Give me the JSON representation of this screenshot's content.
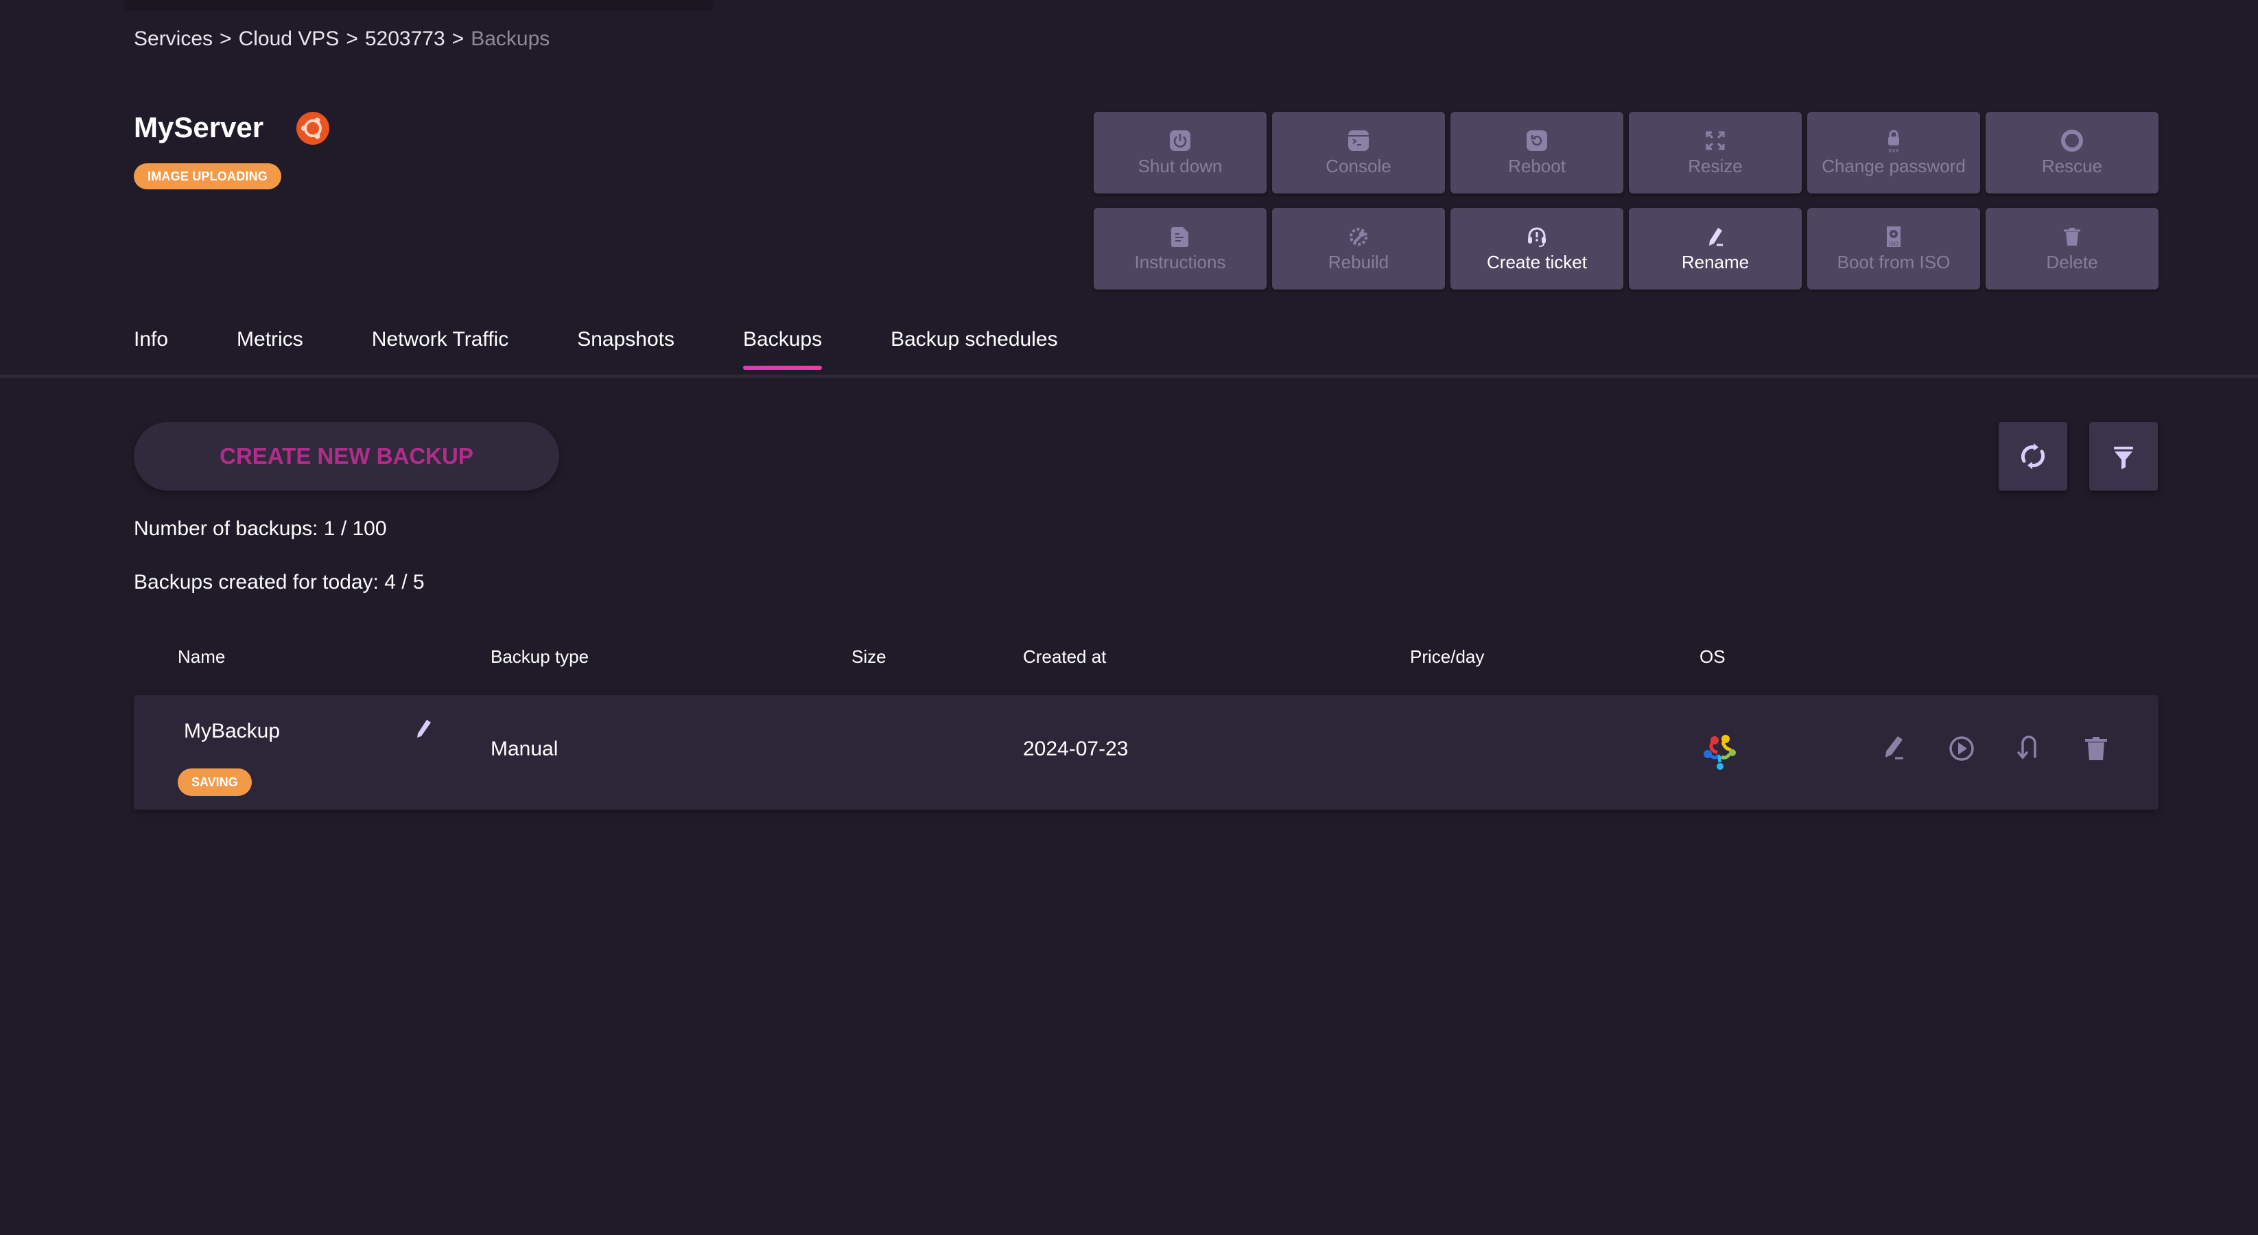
{
  "breadcrumb": [
    {
      "label": "Services"
    },
    {
      "label": "Cloud VPS"
    },
    {
      "label": "5203773"
    },
    {
      "label": "Backups"
    }
  ],
  "breadcrumb_separator": ">",
  "server": {
    "name": "MyServer",
    "os_icon": "ubuntu-logo-icon",
    "status": "IMAGE UPLOADING",
    "status_color": "#f39a48"
  },
  "actions": [
    {
      "label": "Shut down",
      "icon": "power-icon",
      "enabled": false
    },
    {
      "label": "Console",
      "icon": "terminal-icon",
      "enabled": false
    },
    {
      "label": "Reboot",
      "icon": "reboot-icon",
      "enabled": false
    },
    {
      "label": "Resize",
      "icon": "resize-icon",
      "enabled": false
    },
    {
      "label": "Change password",
      "icon": "lock-password-icon",
      "enabled": false
    },
    {
      "label": "Rescue",
      "icon": "lifebuoy-icon",
      "enabled": false
    },
    {
      "label": "Instructions",
      "icon": "document-icon",
      "enabled": false
    },
    {
      "label": "Rebuild",
      "icon": "wrench-gear-icon",
      "enabled": false
    },
    {
      "label": "Create ticket",
      "icon": "headset-icon",
      "enabled": true
    },
    {
      "label": "Rename",
      "icon": "pencil-rename-icon",
      "enabled": true
    },
    {
      "label": "Boot from ISO",
      "icon": "iso-disc-icon",
      "enabled": false
    },
    {
      "label": "Delete",
      "icon": "trash-icon",
      "enabled": false
    }
  ],
  "tabs": [
    {
      "label": "Info",
      "active": false
    },
    {
      "label": "Metrics",
      "active": false
    },
    {
      "label": "Network Traffic",
      "active": false
    },
    {
      "label": "Snapshots",
      "active": false
    },
    {
      "label": "Backups",
      "active": true
    },
    {
      "label": "Backup schedules",
      "active": false
    }
  ],
  "accent_color": "#e03fae",
  "toolbar": {
    "create_label": "CREATE NEW BACKUP",
    "refresh_icon": "refresh-icon",
    "filter_icon": "filter-icon"
  },
  "stats": {
    "backups_count": "Number of backups: 1 / 100",
    "backups_today": "Backups created for today: 4 / 5"
  },
  "table": {
    "columns": [
      "Name",
      "Backup type",
      "Size",
      "Created at",
      "Price/day",
      "OS"
    ],
    "rows": [
      {
        "name": "MyBackup",
        "status": "SAVING",
        "backup_type": "Manual",
        "size": "",
        "created_at": "2024-07-23",
        "price_day": "",
        "os_icon": "os-logo-icon",
        "row_actions": [
          "rename-icon",
          "play-restore-icon",
          "revert-icon",
          "delete-icon"
        ]
      }
    ]
  }
}
